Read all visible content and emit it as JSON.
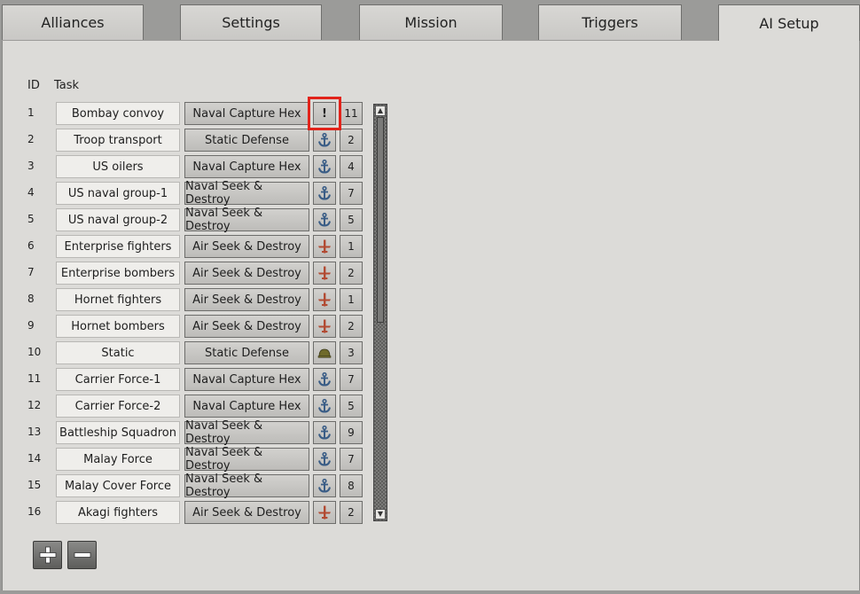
{
  "tabs": [
    {
      "label": "Alliances",
      "active": false
    },
    {
      "label": "Settings",
      "active": false
    },
    {
      "label": "Mission",
      "active": false
    },
    {
      "label": "Triggers",
      "active": false
    },
    {
      "label": "AI Setup",
      "active": true
    }
  ],
  "table": {
    "headers": {
      "id": "ID",
      "task": "Task"
    },
    "rows": [
      {
        "id": "1",
        "name": "Bombay convoy",
        "task": "Naval Capture Hex",
        "icon": "exclamation",
        "count": "11"
      },
      {
        "id": "2",
        "name": "Troop transport",
        "task": "Static Defense",
        "icon": "anchor-icon",
        "count": "2"
      },
      {
        "id": "3",
        "name": "US oilers",
        "task": "Naval Capture Hex",
        "icon": "anchor-icon",
        "count": "4"
      },
      {
        "id": "4",
        "name": "US naval group-1",
        "task": "Naval Seek & Destroy",
        "icon": "anchor-icon",
        "count": "7"
      },
      {
        "id": "5",
        "name": "US naval group-2",
        "task": "Naval Seek & Destroy",
        "icon": "anchor-icon",
        "count": "5"
      },
      {
        "id": "6",
        "name": "Enterprise fighters",
        "task": "Air Seek & Destroy",
        "icon": "airplane-icon",
        "count": "1"
      },
      {
        "id": "7",
        "name": "Enterprise bombers",
        "task": "Air Seek & Destroy",
        "icon": "airplane-icon",
        "count": "2"
      },
      {
        "id": "8",
        "name": "Hornet fighters",
        "task": "Air Seek & Destroy",
        "icon": "airplane-icon",
        "count": "1"
      },
      {
        "id": "9",
        "name": "Hornet bombers",
        "task": "Air Seek & Destroy",
        "icon": "airplane-icon",
        "count": "2"
      },
      {
        "id": "10",
        "name": "Static",
        "task": "Static Defense",
        "icon": "helmet-icon",
        "count": "3"
      },
      {
        "id": "11",
        "name": "Carrier Force-1",
        "task": "Naval Capture Hex",
        "icon": "anchor-icon",
        "count": "7"
      },
      {
        "id": "12",
        "name": "Carrier Force-2",
        "task": "Naval Capture Hex",
        "icon": "anchor-icon",
        "count": "5"
      },
      {
        "id": "13",
        "name": "Battleship Squadron",
        "task": "Naval Seek & Destroy",
        "icon": "anchor-icon",
        "count": "9"
      },
      {
        "id": "14",
        "name": "Malay Force",
        "task": "Naval Seek & Destroy",
        "icon": "anchor-icon",
        "count": "7"
      },
      {
        "id": "15",
        "name": "Malay Cover Force",
        "task": "Naval Seek & Destroy",
        "icon": "anchor-icon",
        "count": "8"
      },
      {
        "id": "16",
        "name": "Akagi fighters",
        "task": "Air Seek & Destroy",
        "icon": "airplane-icon",
        "count": "2"
      }
    ]
  },
  "colors": {
    "highlight": "#e2231a",
    "anchor": "#3a5d86",
    "airplane": "#b24a32",
    "helmet": "#6f6a2a"
  },
  "buttons": {
    "add": "+",
    "remove": "−"
  },
  "exclamation": "!"
}
